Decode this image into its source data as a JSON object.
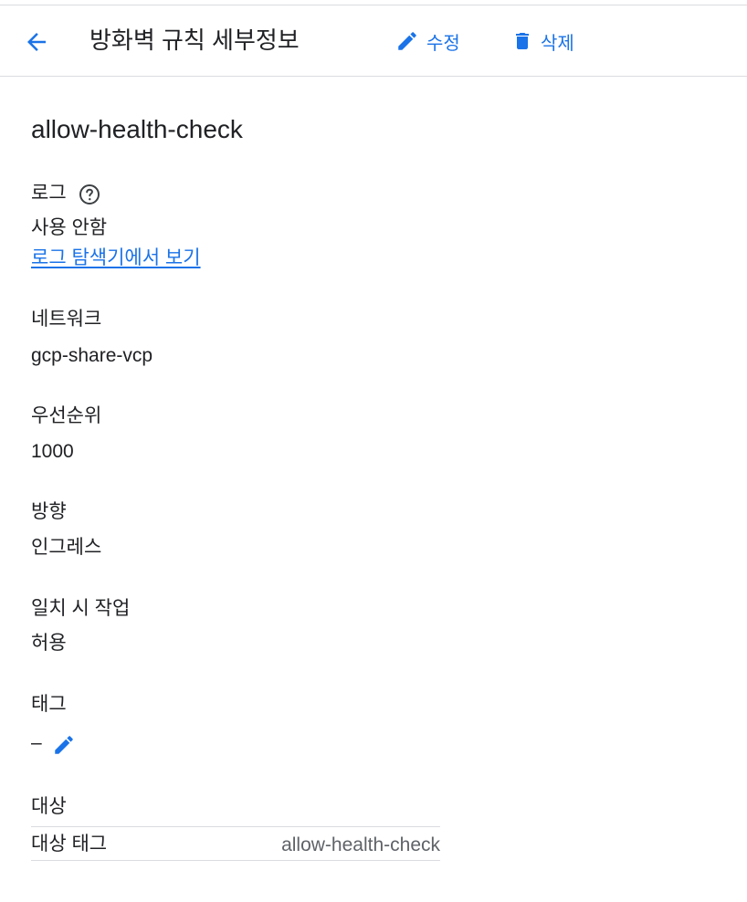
{
  "header": {
    "title": "방화벽 규칙 세부정보",
    "edit_label": "수정",
    "delete_label": "삭제",
    "back_icon": "arrow-back-icon",
    "edit_icon": "pencil-icon",
    "delete_icon": "trash-icon"
  },
  "rule": {
    "name": "allow-health-check",
    "logs": {
      "label": "로그",
      "value": "사용 안함",
      "link": "로그 탐색기에서 보기",
      "help_icon": "help-circle-icon"
    },
    "network": {
      "label": "네트워크",
      "value": "gcp-share-vcp"
    },
    "priority": {
      "label": "우선순위",
      "value": "1000"
    },
    "direction": {
      "label": "방향",
      "value": "인그레스"
    },
    "action": {
      "label": "일치 시 작업",
      "value": "허용"
    },
    "tags": {
      "label": "태그",
      "value": "–",
      "edit_icon": "pencil-icon"
    },
    "targets": {
      "label": "대상",
      "rows": [
        {
          "key": "대상 태그",
          "value": "allow-health-check"
        }
      ]
    }
  },
  "colors": {
    "accent": "#1a73e8",
    "text": "#202124",
    "secondary_text": "#5f6368",
    "divider": "#dadce0"
  }
}
